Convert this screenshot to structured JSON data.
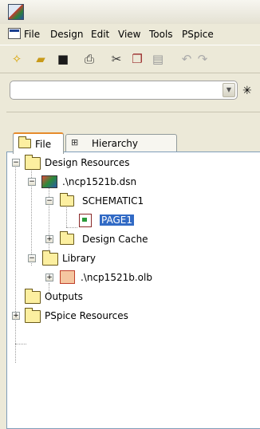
{
  "menu": {
    "items": [
      "File",
      "Design",
      "Edit",
      "View",
      "Tools",
      "PSpice"
    ]
  },
  "toolbar": {
    "icons": [
      "new-file-icon",
      "open-folder-icon",
      "save-icon",
      "print-icon",
      "cut-icon",
      "copy-icon",
      "paste-icon",
      "undo-icon",
      "redo-icon"
    ],
    "combo_value": ""
  },
  "tabs": [
    {
      "label": "File"
    },
    {
      "label": "Hierarchy"
    }
  ],
  "tree": {
    "design_resources": "Design Resources",
    "dsn": ".\\ncp1521b.dsn",
    "schematic": "SCHEMATIC1",
    "page": "PAGE1",
    "design_cache": "Design Cache",
    "library": "Library",
    "olb": ".\\ncp1521b.olb",
    "outputs": "Outputs",
    "pspice_resources": "PSpice Resources"
  },
  "colors": {
    "selection": "#316ac5",
    "folder": "#fcefa0",
    "tab_accent": "#e68b2c"
  }
}
